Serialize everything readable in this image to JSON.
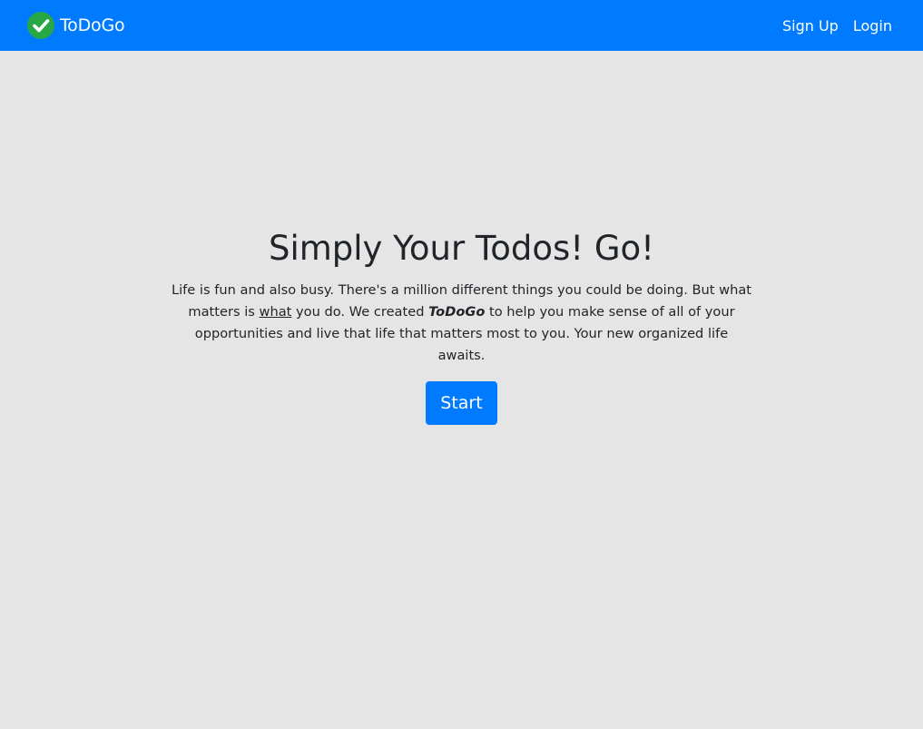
{
  "navbar": {
    "brand_icon": "check-circle-icon",
    "brand_name": "ToDoGo",
    "links": [
      {
        "label": "Sign Up"
      },
      {
        "label": "Login"
      }
    ],
    "color": "#007bff"
  },
  "hero": {
    "title": "Simply Your Todos! Go!",
    "text_part1": "Life is fun and also busy. There's a million different things you could be doing. But what matters is ",
    "text_emphasis": "what",
    "text_part2": " you do. We created ",
    "text_brand": "ToDoGo",
    "text_part3": " to help you make sense of all of your opportunities and live that life that matters most to you. Your new organized life awaits.",
    "button_label": "Start"
  },
  "colors": {
    "primary": "#007bff",
    "success": "#28a745",
    "background": "#e5e5e5",
    "text": "#212529"
  }
}
